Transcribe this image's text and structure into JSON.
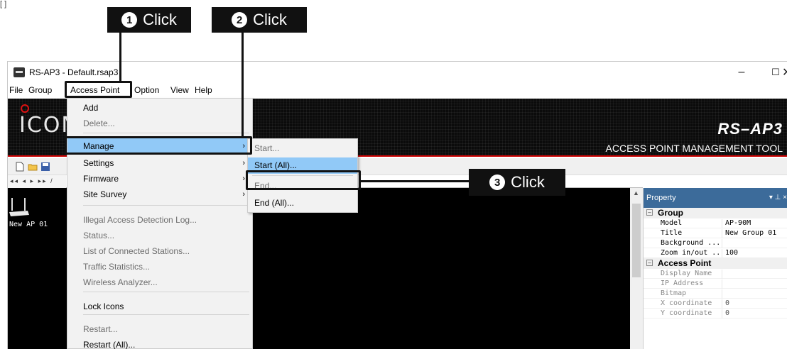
{
  "annotations": {
    "top_mark": "[  ]",
    "callout1": {
      "num": "1",
      "label": "Click"
    },
    "callout2": {
      "num": "2",
      "label": "Click"
    },
    "callout3": {
      "num": "3",
      "label": "Click"
    }
  },
  "window": {
    "title": "RS-AP3 - Default.rsap3",
    "controls": {
      "minimize": "–",
      "maximize": "☐",
      "close": "✕"
    }
  },
  "menubar": [
    "File",
    "Group",
    "Access Point",
    "Option",
    "View",
    "Help"
  ],
  "banner": {
    "logo": "ICOM",
    "brand": "RS–AP3",
    "tagline": "ACCESS POINT MANAGEMENT TOOL"
  },
  "navbar": "◂◂ ◂ ▸ ▸▸ /",
  "tree": {
    "ap_label": "New AP 01"
  },
  "access_point_menu": {
    "items": [
      {
        "label": "Add",
        "disabled": false
      },
      {
        "label": "Delete...",
        "disabled": true
      },
      {
        "label": "Manage",
        "submenu": true,
        "highlighted": true
      },
      {
        "label": "Settings",
        "submenu": true
      },
      {
        "label": "Firmware",
        "submenu": true
      },
      {
        "label": "Site Survey",
        "submenu": true
      },
      {
        "label": "Illegal Access Detection Log...",
        "disabled": true
      },
      {
        "label": "Status...",
        "disabled": true
      },
      {
        "label": "List of Connected Stations...",
        "disabled": true
      },
      {
        "label": "Traffic Statistics...",
        "disabled": true
      },
      {
        "label": "Wireless Analyzer...",
        "disabled": true
      },
      {
        "label": "Lock Icons",
        "disabled": false
      },
      {
        "label": "Restart...",
        "disabled": true
      },
      {
        "label": "Restart (All)...",
        "disabled": false
      }
    ]
  },
  "manage_submenu": {
    "items": [
      {
        "label": "Start...",
        "disabled": true
      },
      {
        "label": "Start (All)...",
        "highlighted": true
      },
      {
        "label": "End...",
        "disabled": true
      },
      {
        "label": "End (All)...",
        "disabled": false
      }
    ]
  },
  "property_panel": {
    "title": "Property",
    "controls": "▾ ⊥ ×",
    "groups": [
      {
        "name": "Group",
        "rows": [
          {
            "key": "Model",
            "value": "AP-90M"
          },
          {
            "key": "Title",
            "value": "New Group 01"
          },
          {
            "key": "Background ...",
            "value": ""
          },
          {
            "key": "Zoom in/out ...",
            "value": "100"
          }
        ]
      },
      {
        "name": "Access Point",
        "rows": [
          {
            "key": "Display Name",
            "value": ""
          },
          {
            "key": "IP Address",
            "value": ""
          },
          {
            "key": "Bitmap",
            "value": ""
          },
          {
            "key": "X coordinate",
            "value": "0"
          },
          {
            "key": "Y coordinate",
            "value": "0"
          }
        ]
      }
    ]
  },
  "colors": {
    "highlight": "#91c9f7",
    "panel_header": "#3c6b9a",
    "accent_red": "#cc0000"
  }
}
